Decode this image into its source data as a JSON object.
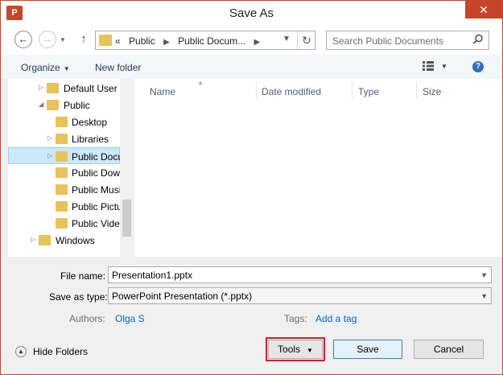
{
  "window": {
    "title": "Save As",
    "app_icon_text": "P",
    "close_glyph": "✕"
  },
  "nav": {
    "back_glyph": "←",
    "forward_glyph": "→",
    "up_glyph": "↑",
    "address_prefix": "«",
    "breadcrumbs": [
      "Public",
      "Public Docum..."
    ],
    "refresh_glyph": "↻",
    "search_placeholder": "Search Public Documents"
  },
  "toolbar": {
    "organize_label": "Organize",
    "new_folder_label": "New folder",
    "help_glyph": "?"
  },
  "tree": {
    "items": [
      {
        "label": "Default User",
        "expander": "▷"
      },
      {
        "label": "Public",
        "expander": "◢"
      },
      {
        "label": "Desktop",
        "expander": ""
      },
      {
        "label": "Libraries",
        "expander": "▷"
      },
      {
        "label": "Public Docu",
        "expander": "▷",
        "selected": true
      },
      {
        "label": "Public Dow",
        "expander": ""
      },
      {
        "label": "Public Musi",
        "expander": ""
      },
      {
        "label": "Public Pictu",
        "expander": ""
      },
      {
        "label": "Public Vide",
        "expander": ""
      },
      {
        "label": "Windows",
        "expander": "▷"
      }
    ]
  },
  "files": {
    "columns": [
      "Name",
      "Date modified",
      "Type",
      "Size"
    ]
  },
  "form": {
    "file_name_label": "File name:",
    "file_name_value": "Presentation1.pptx",
    "save_type_label": "Save as type:",
    "save_type_value": "PowerPoint Presentation (*.pptx)",
    "authors_label": "Authors:",
    "authors_value": "Olga S",
    "tags_label": "Tags:",
    "tags_value": "Add a tag"
  },
  "footer": {
    "hide_folders_label": "Hide Folders",
    "tools_label": "Tools",
    "save_label": "Save",
    "cancel_label": "Cancel"
  },
  "colors": {
    "accent_border": "#bf4b2c",
    "selection": "#cce8ff",
    "link": "#0066cc",
    "highlight_outline": "#d3202a"
  }
}
